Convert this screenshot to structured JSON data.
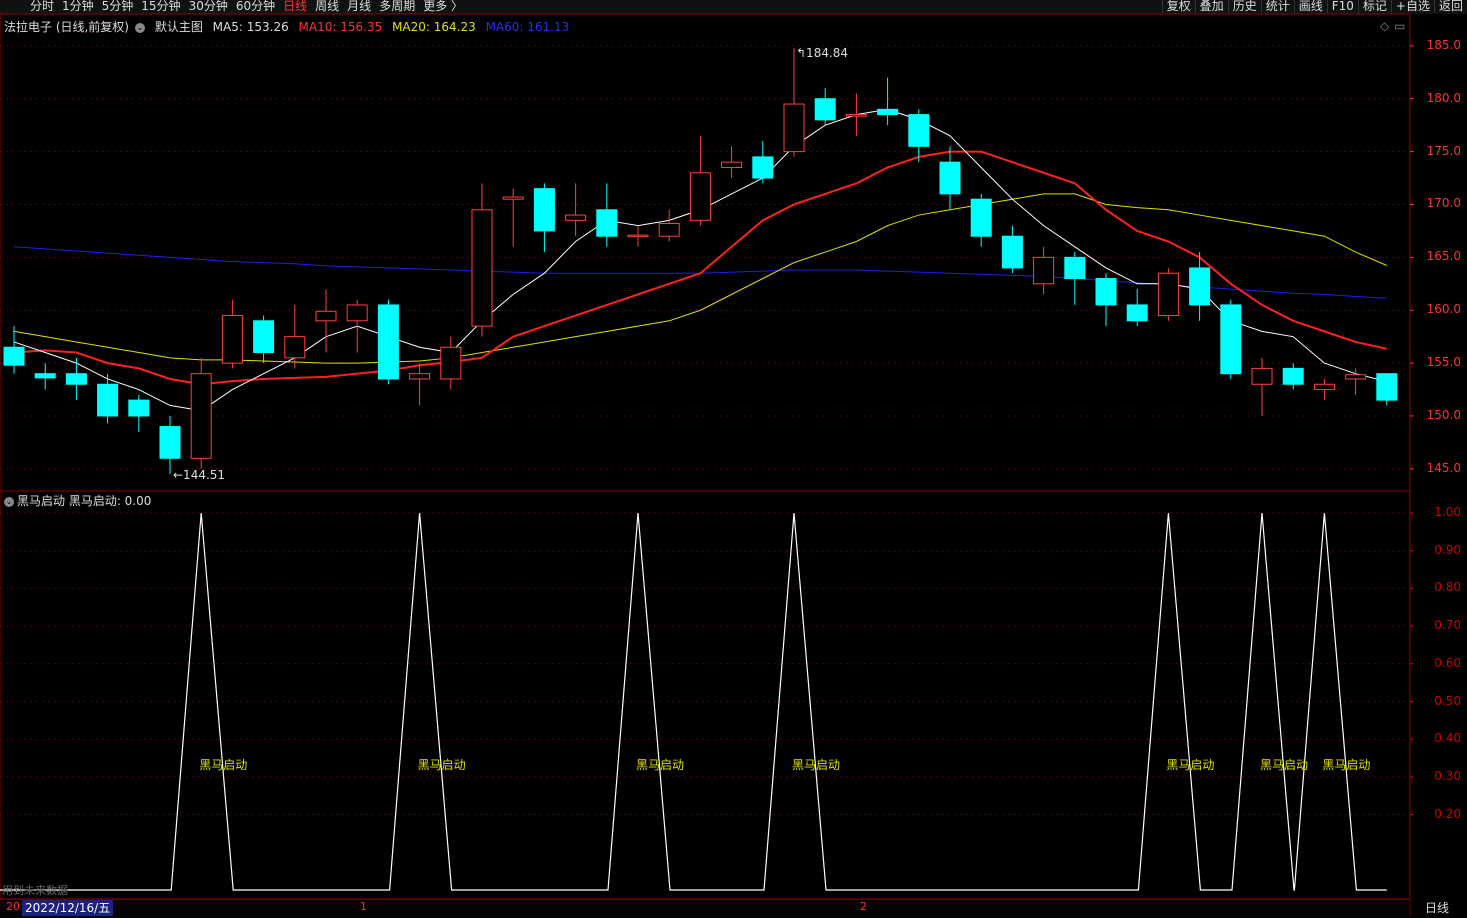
{
  "toolbar": {
    "periods": [
      "分时",
      "1分钟",
      "5分钟",
      "15分钟",
      "30分钟",
      "60分钟",
      "日线",
      "周线",
      "月线",
      "多周期",
      "更多 〉"
    ],
    "active_period": "日线",
    "tools": [
      "复权",
      "叠加",
      "历史",
      "统计",
      "画线",
      "F10",
      "标记",
      "+自选",
      "返回"
    ]
  },
  "legend": {
    "title": "法拉电子 (日线,前复权)",
    "template": "默认主图",
    "ma5": "MA5: 153.26",
    "ma10": "MA10: 156.35",
    "ma20": "MA20: 164.23",
    "ma60": "MA60: 161.13"
  },
  "indicator": {
    "legend": "黑马启动  黑马启动: 0.00",
    "signal_label": "黑马启动"
  },
  "annotations": {
    "high": "184.84",
    "low": "←144.51"
  },
  "price_axis": [
    "185.0",
    "180.0",
    "175.0",
    "170.0",
    "165.0",
    "160.0",
    "155.0",
    "150.0",
    "145.0"
  ],
  "indicator_axis": [
    "1.00",
    "0.90",
    "0.80",
    "0.70",
    "0.60",
    "0.50",
    "0.40",
    "0.30",
    "0.20"
  ],
  "footer": {
    "selected_date": "2022/12/16/五",
    "ticks": [
      "20",
      "1",
      "2"
    ],
    "period_badge": "日线",
    "future_note": "用到未来数据"
  },
  "colors": {
    "up": "#ff4040",
    "down": "#00ffff",
    "ma5": "#ffffff",
    "ma10": "#ff2020",
    "ma20": "#e0e000",
    "ma60": "#2020e0",
    "axis": "#ff3030"
  },
  "chart_data": {
    "type": "candlestick",
    "candles": [
      [
        156.5,
        154.8,
        158.5,
        154.0
      ],
      [
        154.0,
        153.6,
        155.0,
        152.5
      ],
      [
        154.0,
        153.0,
        155.5,
        151.5
      ],
      [
        153.0,
        150.0,
        154.0,
        149.3
      ],
      [
        151.5,
        150.0,
        152.0,
        148.5
      ],
      [
        149.0,
        146.0,
        150.0,
        144.5
      ],
      [
        146.0,
        154.0,
        155.5,
        145.0
      ],
      [
        155.0,
        159.5,
        161.0,
        154.5
      ],
      [
        159.0,
        156.0,
        159.5,
        155.0
      ],
      [
        155.5,
        157.5,
        160.5,
        154.5
      ],
      [
        159.0,
        159.9,
        162.0,
        156.0
      ],
      [
        159.0,
        160.5,
        161.0,
        156.0
      ],
      [
        160.5,
        153.5,
        161.0,
        153.0
      ],
      [
        153.5,
        154.0,
        155.0,
        151.0
      ],
      [
        153.5,
        156.5,
        157.5,
        152.5
      ],
      [
        158.5,
        169.5,
        172.0,
        157.5
      ],
      [
        170.5,
        170.7,
        171.5,
        166.0
      ],
      [
        171.5,
        167.5,
        172.0,
        165.5
      ],
      [
        168.5,
        169.0,
        172.0,
        167.0
      ],
      [
        169.5,
        167.0,
        172.0,
        166.0
      ],
      [
        167.0,
        167.1,
        168.0,
        166.0
      ],
      [
        167.0,
        168.2,
        169.5,
        166.5
      ],
      [
        168.5,
        173.0,
        176.5,
        168.0
      ],
      [
        173.5,
        174.0,
        175.5,
        172.5
      ],
      [
        174.5,
        172.5,
        176.0,
        172.0
      ],
      [
        175.0,
        179.5,
        184.8,
        174.5
      ],
      [
        180.0,
        178.0,
        181.0,
        177.5
      ],
      [
        178.5,
        178.5,
        180.5,
        176.5
      ],
      [
        179.0,
        178.5,
        182.0,
        177.5
      ],
      [
        178.5,
        175.5,
        179.0,
        174.0
      ],
      [
        174.0,
        171.0,
        175.5,
        169.5
      ],
      [
        170.5,
        167.0,
        171.0,
        166.0
      ],
      [
        167.0,
        164.0,
        168.0,
        163.5
      ],
      [
        162.5,
        165.0,
        166.0,
        161.5
      ],
      [
        165.0,
        163.0,
        165.5,
        160.5
      ],
      [
        163.0,
        160.5,
        163.5,
        158.5
      ],
      [
        160.5,
        159.0,
        162.0,
        158.5
      ],
      [
        159.5,
        163.5,
        164.0,
        159.0
      ],
      [
        164.0,
        160.5,
        165.5,
        159.0
      ],
      [
        160.5,
        154.0,
        161.0,
        153.5
      ],
      [
        153.0,
        154.5,
        155.5,
        150.0
      ],
      [
        154.5,
        153.0,
        155.0,
        152.5
      ],
      [
        152.5,
        153.0,
        153.5,
        151.5
      ],
      [
        153.5,
        153.9,
        154.5,
        152.0
      ],
      [
        154.0,
        151.5,
        154.0,
        151.0
      ]
    ],
    "candle_fields": [
      "open",
      "close",
      "high",
      "low"
    ],
    "ma5": [
      157.0,
      156.0,
      155.0,
      153.5,
      152.5,
      151.0,
      150.5,
      152.5,
      154.0,
      155.5,
      157.5,
      158.5,
      157.5,
      156.5,
      156.0,
      159.0,
      161.5,
      163.5,
      166.5,
      168.5,
      168.0,
      168.5,
      169.5,
      171.0,
      172.5,
      175.5,
      177.5,
      178.5,
      179.0,
      178.0,
      176.5,
      173.5,
      170.5,
      168.0,
      166.0,
      164.0,
      162.5,
      162.5,
      162.0,
      159.0,
      158.0,
      157.5,
      155.0,
      154.0,
      153.26
    ],
    "ma10": [
      156.0,
      156.2,
      156.0,
      155.0,
      154.5,
      153.5,
      153.0,
      153.3,
      153.5,
      153.6,
      153.7,
      154.0,
      154.3,
      154.8,
      155.1,
      155.5,
      157.5,
      158.5,
      159.5,
      160.5,
      161.5,
      162.5,
      163.5,
      166.0,
      168.5,
      170.0,
      171.0,
      172.0,
      173.5,
      174.5,
      175.0,
      175.0,
      174.0,
      173.0,
      172.0,
      169.5,
      167.5,
      166.5,
      165.0,
      162.5,
      160.5,
      159.0,
      158.0,
      157.0,
      156.35
    ],
    "ma20": [
      158.0,
      157.5,
      157.0,
      156.5,
      156.0,
      155.5,
      155.3,
      155.3,
      155.2,
      155.1,
      155.0,
      155.0,
      155.1,
      155.2,
      155.5,
      156.0,
      156.5,
      157.0,
      157.5,
      158.0,
      158.5,
      159.0,
      160.0,
      161.5,
      163.0,
      164.5,
      165.5,
      166.5,
      168.0,
      169.0,
      169.5,
      170.0,
      170.5,
      171.0,
      171.0,
      170.0,
      169.7,
      169.5,
      169.0,
      168.5,
      168.0,
      167.5,
      167.0,
      165.5,
      164.23
    ],
    "ma60": [
      166.0,
      165.8,
      165.6,
      165.4,
      165.2,
      165.0,
      164.8,
      164.6,
      164.5,
      164.4,
      164.2,
      164.1,
      164.0,
      163.9,
      163.8,
      163.7,
      163.6,
      163.5,
      163.5,
      163.5,
      163.5,
      163.5,
      163.5,
      163.6,
      163.7,
      163.8,
      163.8,
      163.8,
      163.7,
      163.6,
      163.5,
      163.4,
      163.3,
      163.2,
      163.0,
      162.8,
      162.6,
      162.4,
      162.2,
      162.0,
      161.8,
      161.6,
      161.5,
      161.3,
      161.13
    ],
    "ylim": [
      143.0,
      186.5
    ],
    "indicator": {
      "name": "黑马启动",
      "signal_indices": [
        6,
        13,
        20,
        25,
        37,
        40,
        42
      ],
      "ylim": [
        0,
        1
      ]
    }
  }
}
